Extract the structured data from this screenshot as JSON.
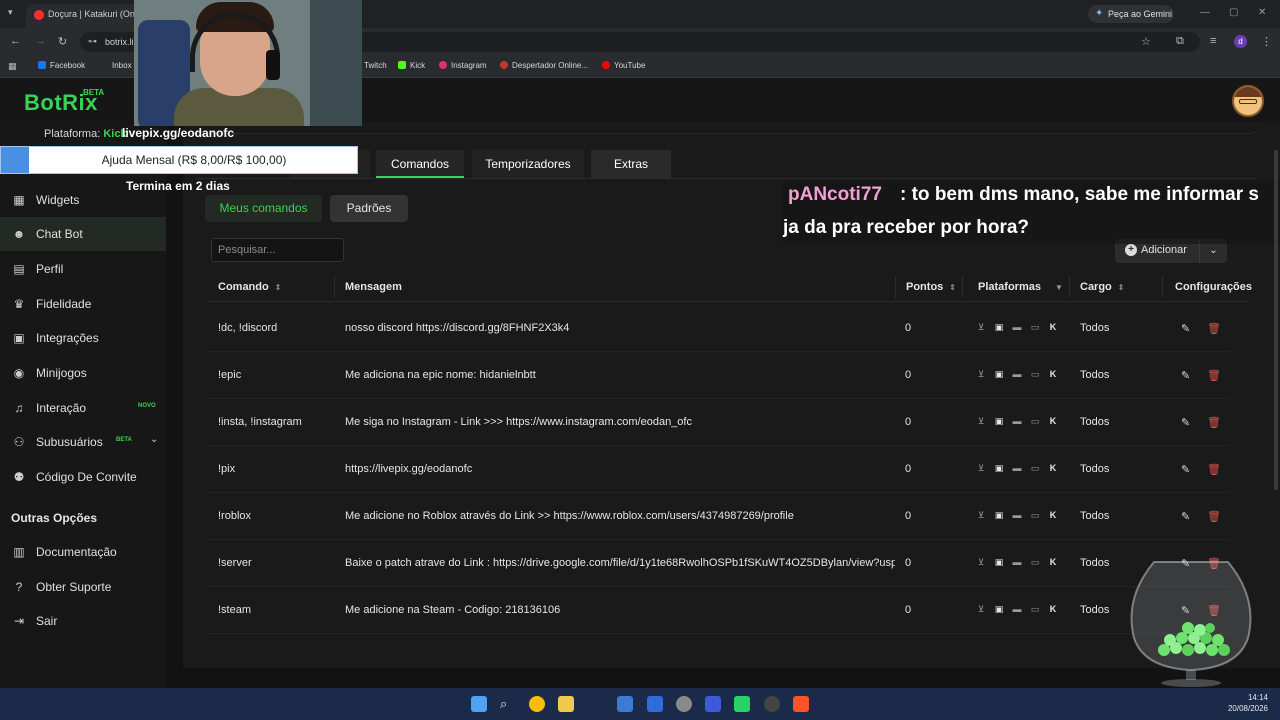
{
  "browser": {
    "active_tab_title": "Doçura | Katakuri (One P",
    "gemini_button": "Peça ao Gemini",
    "url": "botrix.li",
    "bookmarks": [
      {
        "label": "Facebook",
        "color": "#1877f2"
      },
      {
        "label": "Inbox",
        "color": "#c0392b"
      },
      {
        "label": "Twitch",
        "color": "#9146ff"
      },
      {
        "label": "Kick",
        "color": "#53fc18"
      },
      {
        "label": "Instagram",
        "color": "#e1306c"
      },
      {
        "label": "Despertador Online...",
        "color": "#c0392b"
      },
      {
        "label": "YouTube",
        "color": "#ff0000"
      }
    ]
  },
  "app": {
    "logo": "BotRix",
    "logo_badge": "BETA"
  },
  "stream_overlay": {
    "plataforma_label": "Plataforma:",
    "plataforma_value": "Kick",
    "livepix": "livepix.gg/eodanofc",
    "goal_text": "Ajuda Mensal (R$ 8,00/R$ 100,00)",
    "goal_progress_percent": 8,
    "goal_end": "Termina em 2 dias",
    "chat_user": "pANcoti77",
    "chat_message_line1": ": to bem dms mano, sabe me informar s",
    "chat_message_line2": "ja da pra receber por hora?"
  },
  "sidebar": {
    "items": [
      {
        "label": "Widgets",
        "icon": "grid-icon"
      },
      {
        "label": "Chat Bot",
        "icon": "robot-icon",
        "active": true
      },
      {
        "label": "Perfil",
        "icon": "id-card-icon"
      },
      {
        "label": "Fidelidade",
        "icon": "trophy-icon"
      },
      {
        "label": "Integrações",
        "icon": "integration-icon"
      },
      {
        "label": "Minijogos",
        "icon": "gamepad-icon"
      },
      {
        "label": "Interação",
        "icon": "music-icon",
        "badge": "NOVO"
      },
      {
        "label": "Subusuários",
        "icon": "users-icon",
        "badge": "BETA"
      },
      {
        "label": "Código De Convite",
        "icon": "user-group-icon"
      }
    ],
    "section_title": "Outras Opções",
    "other_items": [
      {
        "label": "Documentação",
        "icon": "document-icon"
      },
      {
        "label": "Obter Suporte",
        "icon": "help-icon"
      },
      {
        "label": "Sair",
        "icon": "logout-icon"
      }
    ]
  },
  "main": {
    "tabs": [
      {
        "label": "Comandos",
        "active": true
      },
      {
        "label": "Temporizadores"
      },
      {
        "label": "Extras"
      }
    ],
    "subtabs": {
      "meus": "Meus comandos",
      "padroes": "Padrões"
    },
    "search_placeholder": "Pesquisar...",
    "add_button": "Adicionar",
    "columns": {
      "comando": "Comando",
      "mensagem": "Mensagem",
      "pontos": "Pontos",
      "plataformas": "Plataformas",
      "cargo": "Cargo",
      "configuracoes": "Configurações"
    },
    "rows": [
      {
        "comando": "!dc, !discord",
        "mensagem": "nosso discord https://discord.gg/8FHNF2X3k4",
        "pontos": "0",
        "cargo": "Todos"
      },
      {
        "comando": "!epic",
        "mensagem": "Me adiciona na epic nome: hidanielnbtt",
        "pontos": "0",
        "cargo": "Todos"
      },
      {
        "comando": "!insta, !instagram",
        "mensagem": "Me siga no Instagram - Link >>> https://www.instagram.com/eodan_ofc",
        "pontos": "0",
        "cargo": "Todos"
      },
      {
        "comando": "!pix",
        "mensagem": "https://livepix.gg/eodanofc",
        "pontos": "0",
        "cargo": "Todos"
      },
      {
        "comando": "!roblox",
        "mensagem": "Me adicione no Roblox através do Link >> https://www.roblox.com/users/4374987269/profile",
        "pontos": "0",
        "cargo": "Todos"
      },
      {
        "comando": "!server",
        "mensagem": "Baixe o patch atrave do Link : https://drive.google.com/file/d/1y1te68RwolhOSPb1fSKuWT4OZ5DBylan/view?usp=sl",
        "pontos": "0",
        "cargo": "Todos"
      },
      {
        "comando": "!steam",
        "mensagem": "Me adicione na Steam - Codigo: 218136106",
        "pontos": "0",
        "cargo": "Todos"
      }
    ]
  },
  "taskbar": {
    "time": "14:14",
    "date": "20/08/2026"
  }
}
